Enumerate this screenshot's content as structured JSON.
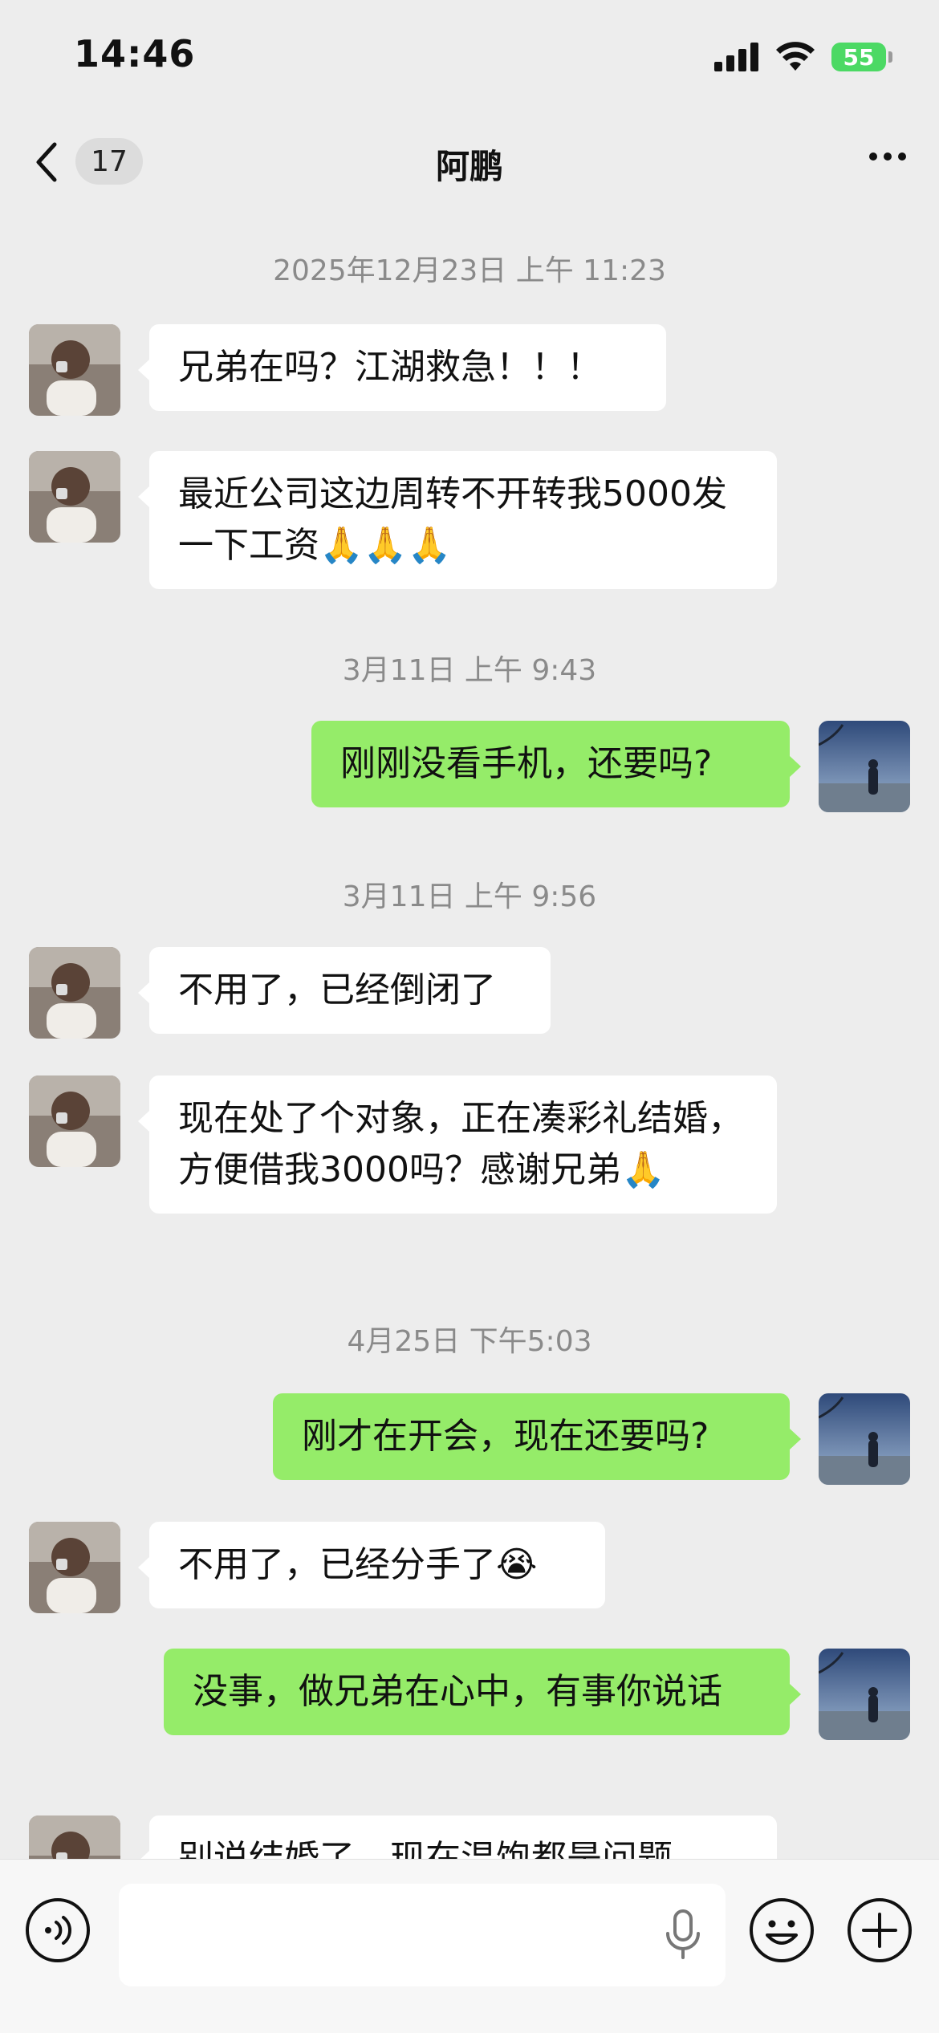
{
  "status": {
    "time": "14:46",
    "battery": "55"
  },
  "nav": {
    "unread_count": "17",
    "title": "阿鹏"
  },
  "messages": [
    {
      "type": "time",
      "text": "2025年12月23日 上午 11:23"
    },
    {
      "type": "in",
      "text": "兄弟在吗？江湖救急！！！"
    },
    {
      "type": "in",
      "text": "最近公司这边周转不开转我5000发一下工资🙏🙏🙏"
    },
    {
      "type": "time",
      "text": "3月11日 上午 9:43"
    },
    {
      "type": "out",
      "text": "刚刚没看手机，还要吗?"
    },
    {
      "type": "time",
      "text": "3月11日 上午 9:56"
    },
    {
      "type": "in",
      "text": "不用了，已经倒闭了"
    },
    {
      "type": "in",
      "text": "现在处了个对象，正在凑彩礼结婚，方便借我3000吗？感谢兄弟🙏"
    },
    {
      "type": "time",
      "text": "4月25日 下午5:03"
    },
    {
      "type": "out",
      "text": "刚才在开会，现在还要吗?"
    },
    {
      "type": "in",
      "text": "不用了，已经分手了😭"
    },
    {
      "type": "out",
      "text": "没事，做兄弟在心中，有事你说话"
    },
    {
      "type": "in",
      "text": "别说结婚了，现在温饱都是问题"
    }
  ],
  "colors": {
    "incoming_bubble": "#ffffff",
    "outgoing_bubble": "#95ec69",
    "background": "#ededed"
  }
}
